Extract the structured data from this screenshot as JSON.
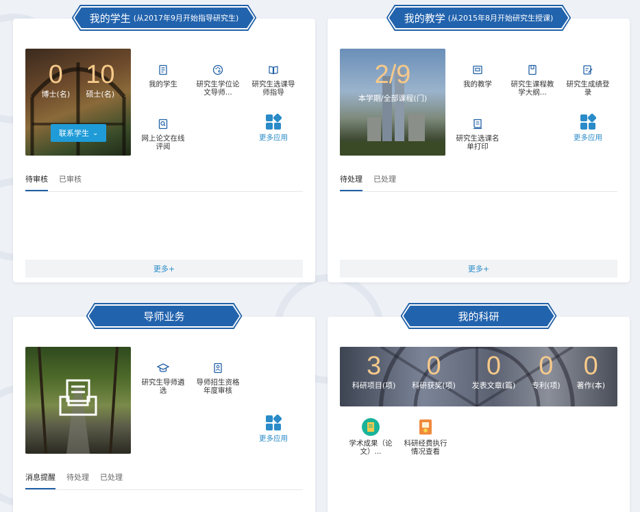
{
  "cards": {
    "students": {
      "title": "我的学生",
      "subtitle": "(从2017年9月开始指导研究生)",
      "stats": [
        {
          "value": "0",
          "label": "博士(名)"
        },
        {
          "value": "10",
          "label": "硕士(名)"
        }
      ],
      "contact_label": "联系学生",
      "apps": [
        {
          "label": "我的学生",
          "icon": "document-icon"
        },
        {
          "label": "研究生学位论文导师...",
          "icon": "palette-icon"
        },
        {
          "label": "研究生选课导师指导",
          "icon": "book-icon"
        },
        {
          "label": "网上论文在线评阅",
          "icon": "search-doc-icon"
        }
      ],
      "more_apps_label": "更多应用",
      "tabs": [
        "待审核",
        "已审核"
      ],
      "more_label": "更多+"
    },
    "teaching": {
      "title": "我的教学",
      "subtitle": "(从2015年8月开始研究生授课)",
      "stat_value": "2/9",
      "stat_label": "本学期/全部课程(门)",
      "apps": [
        {
          "label": "我的教学",
          "icon": "image-icon"
        },
        {
          "label": "研究生课程教学大纲...",
          "icon": "notebook-icon"
        },
        {
          "label": "研究生成绩登录",
          "icon": "edit-icon"
        },
        {
          "label": "研究生选课名单打印",
          "icon": "receipt-icon"
        }
      ],
      "more_apps_label": "更多应用",
      "tabs": [
        "待处理",
        "已处理"
      ],
      "more_label": "更多+"
    },
    "advisor": {
      "title": "导师业务",
      "apps": [
        {
          "label": "研究生导师遴选",
          "icon": "graduation-cap-icon"
        },
        {
          "label": "导师招生资格年度审核",
          "icon": "id-card-icon"
        }
      ],
      "more_apps_label": "更多应用",
      "tabs": [
        "消息提醒",
        "待处理",
        "已处理"
      ]
    },
    "research": {
      "title": "我的科研",
      "stats": [
        {
          "value": "3",
          "label": "科研项目(项)"
        },
        {
          "value": "0",
          "label": "科研获奖(项)"
        },
        {
          "value": "0",
          "label": "发表文章(篇)"
        },
        {
          "value": "0",
          "label": "专利(项)"
        },
        {
          "value": "0",
          "label": "著作(本)"
        }
      ],
      "apps": [
        {
          "label": "学术成果（论文）...",
          "icon": "academic-icon"
        },
        {
          "label": "科研经费执行情况查看",
          "icon": "funding-icon"
        }
      ]
    }
  },
  "colors": {
    "ribbon": "#2263ad",
    "accent": "#2a8bc8",
    "stat_number": "#f6c98a"
  }
}
